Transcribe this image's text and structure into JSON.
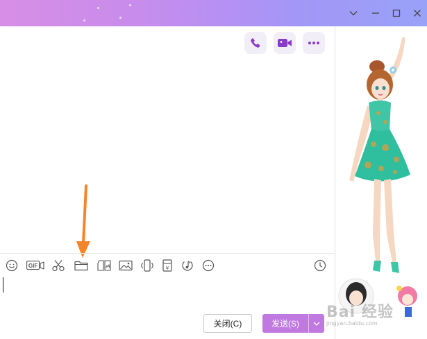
{
  "colors": {
    "accent": "#c079e0",
    "icon_purple": "#8a3cc9",
    "arrow_orange": "#f5852a"
  },
  "titlebar": {
    "controls": [
      "chevron-down-icon",
      "minimize-icon",
      "maximize-icon",
      "close-icon"
    ]
  },
  "call_buttons": [
    "phone-icon",
    "video-camera-icon",
    "more-dots-icon"
  ],
  "toolbar": {
    "items": [
      "emoji-icon",
      "gif-icon",
      "scissors-icon",
      "folder-icon",
      "screenshot-edit-icon",
      "image-icon",
      "shake-icon",
      "red-packet-icon",
      "music-icon",
      "more-icon",
      "history-clock-icon"
    ],
    "gif_label": "GIF",
    "red_packet_symbol": "¥"
  },
  "footer": {
    "close_label": "关闭(C)",
    "send_label": "发送(S)"
  },
  "watermark": {
    "main": "Bai 经验",
    "sub": "jingyan.baidu.com"
  }
}
